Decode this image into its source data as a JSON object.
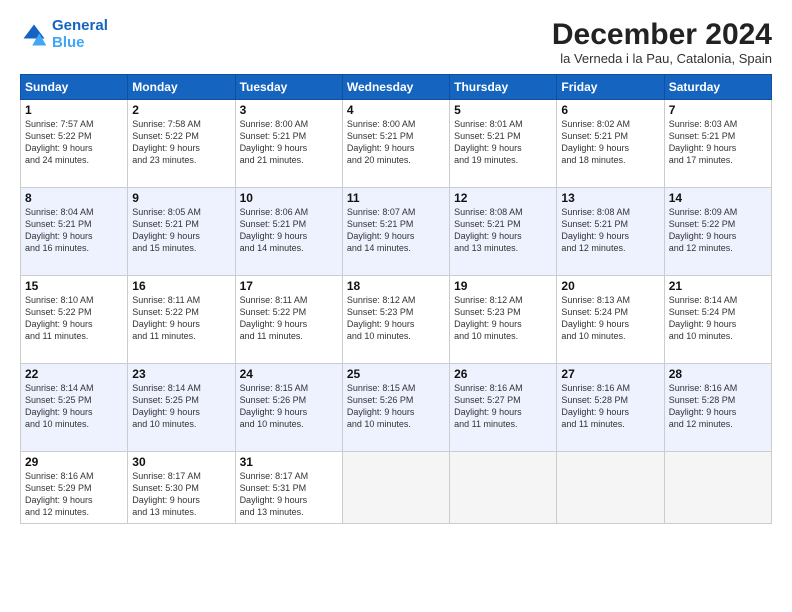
{
  "header": {
    "logo_line1": "General",
    "logo_line2": "Blue",
    "month": "December 2024",
    "location": "la Verneda i la Pau, Catalonia, Spain"
  },
  "weekdays": [
    "Sunday",
    "Monday",
    "Tuesday",
    "Wednesday",
    "Thursday",
    "Friday",
    "Saturday"
  ],
  "weeks": [
    [
      {
        "day": "1",
        "info": "Sunrise: 7:57 AM\nSunset: 5:22 PM\nDaylight: 9 hours\nand 24 minutes."
      },
      {
        "day": "2",
        "info": "Sunrise: 7:58 AM\nSunset: 5:22 PM\nDaylight: 9 hours\nand 23 minutes."
      },
      {
        "day": "3",
        "info": "Sunrise: 8:00 AM\nSunset: 5:21 PM\nDaylight: 9 hours\nand 21 minutes."
      },
      {
        "day": "4",
        "info": "Sunrise: 8:00 AM\nSunset: 5:21 PM\nDaylight: 9 hours\nand 20 minutes."
      },
      {
        "day": "5",
        "info": "Sunrise: 8:01 AM\nSunset: 5:21 PM\nDaylight: 9 hours\nand 19 minutes."
      },
      {
        "day": "6",
        "info": "Sunrise: 8:02 AM\nSunset: 5:21 PM\nDaylight: 9 hours\nand 18 minutes."
      },
      {
        "day": "7",
        "info": "Sunrise: 8:03 AM\nSunset: 5:21 PM\nDaylight: 9 hours\nand 17 minutes."
      }
    ],
    [
      {
        "day": "8",
        "info": "Sunrise: 8:04 AM\nSunset: 5:21 PM\nDaylight: 9 hours\nand 16 minutes."
      },
      {
        "day": "9",
        "info": "Sunrise: 8:05 AM\nSunset: 5:21 PM\nDaylight: 9 hours\nand 15 minutes."
      },
      {
        "day": "10",
        "info": "Sunrise: 8:06 AM\nSunset: 5:21 PM\nDaylight: 9 hours\nand 14 minutes."
      },
      {
        "day": "11",
        "info": "Sunrise: 8:07 AM\nSunset: 5:21 PM\nDaylight: 9 hours\nand 14 minutes."
      },
      {
        "day": "12",
        "info": "Sunrise: 8:08 AM\nSunset: 5:21 PM\nDaylight: 9 hours\nand 13 minutes."
      },
      {
        "day": "13",
        "info": "Sunrise: 8:08 AM\nSunset: 5:21 PM\nDaylight: 9 hours\nand 12 minutes."
      },
      {
        "day": "14",
        "info": "Sunrise: 8:09 AM\nSunset: 5:22 PM\nDaylight: 9 hours\nand 12 minutes."
      }
    ],
    [
      {
        "day": "15",
        "info": "Sunrise: 8:10 AM\nSunset: 5:22 PM\nDaylight: 9 hours\nand 11 minutes."
      },
      {
        "day": "16",
        "info": "Sunrise: 8:11 AM\nSunset: 5:22 PM\nDaylight: 9 hours\nand 11 minutes."
      },
      {
        "day": "17",
        "info": "Sunrise: 8:11 AM\nSunset: 5:22 PM\nDaylight: 9 hours\nand 11 minutes."
      },
      {
        "day": "18",
        "info": "Sunrise: 8:12 AM\nSunset: 5:23 PM\nDaylight: 9 hours\nand 10 minutes."
      },
      {
        "day": "19",
        "info": "Sunrise: 8:12 AM\nSunset: 5:23 PM\nDaylight: 9 hours\nand 10 minutes."
      },
      {
        "day": "20",
        "info": "Sunrise: 8:13 AM\nSunset: 5:24 PM\nDaylight: 9 hours\nand 10 minutes."
      },
      {
        "day": "21",
        "info": "Sunrise: 8:14 AM\nSunset: 5:24 PM\nDaylight: 9 hours\nand 10 minutes."
      }
    ],
    [
      {
        "day": "22",
        "info": "Sunrise: 8:14 AM\nSunset: 5:25 PM\nDaylight: 9 hours\nand 10 minutes."
      },
      {
        "day": "23",
        "info": "Sunrise: 8:14 AM\nSunset: 5:25 PM\nDaylight: 9 hours\nand 10 minutes."
      },
      {
        "day": "24",
        "info": "Sunrise: 8:15 AM\nSunset: 5:26 PM\nDaylight: 9 hours\nand 10 minutes."
      },
      {
        "day": "25",
        "info": "Sunrise: 8:15 AM\nSunset: 5:26 PM\nDaylight: 9 hours\nand 10 minutes."
      },
      {
        "day": "26",
        "info": "Sunrise: 8:16 AM\nSunset: 5:27 PM\nDaylight: 9 hours\nand 11 minutes."
      },
      {
        "day": "27",
        "info": "Sunrise: 8:16 AM\nSunset: 5:28 PM\nDaylight: 9 hours\nand 11 minutes."
      },
      {
        "day": "28",
        "info": "Sunrise: 8:16 AM\nSunset: 5:28 PM\nDaylight: 9 hours\nand 12 minutes."
      }
    ],
    [
      {
        "day": "29",
        "info": "Sunrise: 8:16 AM\nSunset: 5:29 PM\nDaylight: 9 hours\nand 12 minutes."
      },
      {
        "day": "30",
        "info": "Sunrise: 8:17 AM\nSunset: 5:30 PM\nDaylight: 9 hours\nand 13 minutes."
      },
      {
        "day": "31",
        "info": "Sunrise: 8:17 AM\nSunset: 5:31 PM\nDaylight: 9 hours\nand 13 minutes."
      },
      null,
      null,
      null,
      null
    ]
  ]
}
